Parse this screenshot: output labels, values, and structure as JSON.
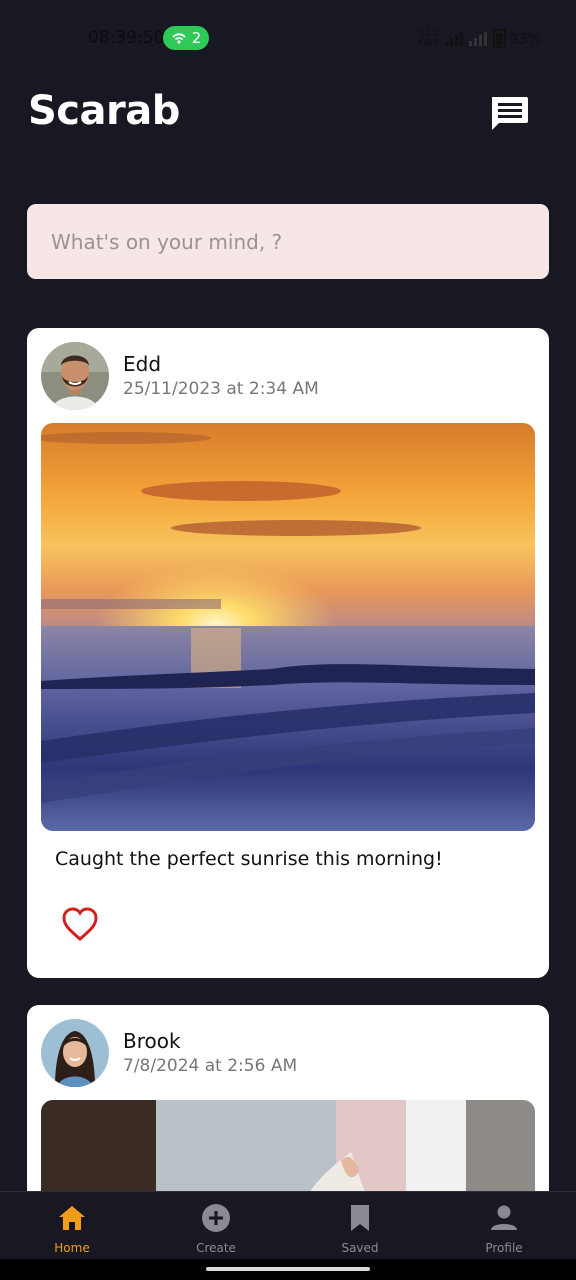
{
  "status_bar": {
    "time": "08:39:50",
    "hotspot_count": "2",
    "net_speed_top": "94.0",
    "net_speed_unit": "KB/S",
    "battery": "93%"
  },
  "header": {
    "title": "Scarab",
    "chat_icon": "chat-bubble-icon"
  },
  "composer": {
    "placeholder": "What's on your mind, ?"
  },
  "posts": [
    {
      "author": "Edd",
      "date": "25/11/2023 at 2:34 AM",
      "caption": "Caught the perfect sunrise this morning!",
      "image": "sunrise-over-ocean",
      "like_icon": "heart-outline-icon"
    },
    {
      "author": "Brook",
      "date": "7/8/2024 at 2:56 AM",
      "image": "cat-by-window"
    }
  ],
  "nav": {
    "items": [
      {
        "label": "Home",
        "icon": "home-icon",
        "active": true
      },
      {
        "label": "Create",
        "icon": "add-circle-icon",
        "active": false
      },
      {
        "label": "Saved",
        "icon": "bookmark-icon",
        "active": false
      },
      {
        "label": "Profile",
        "icon": "person-icon",
        "active": false
      }
    ]
  },
  "colors": {
    "background": "#171821",
    "accent": "#f19d1b",
    "composer_bg": "#f7e6e6",
    "like_red": "#d42020"
  }
}
